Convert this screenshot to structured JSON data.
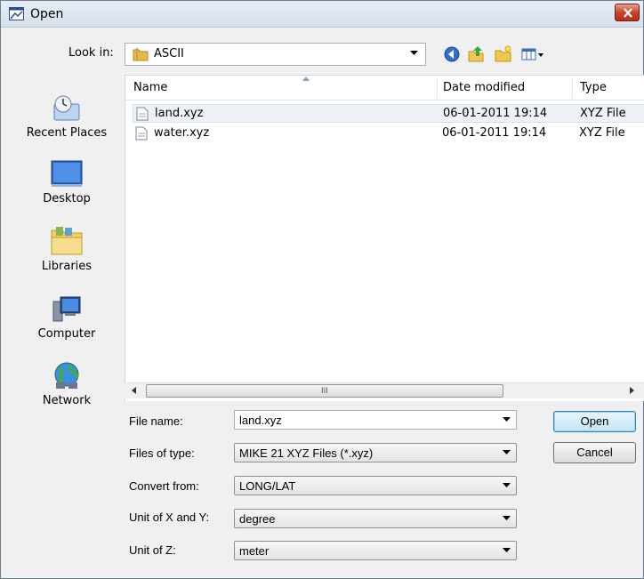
{
  "window": {
    "title": "Open"
  },
  "toolbar": {
    "look_in_label": "Look in:",
    "look_in_value": "ASCII",
    "icons": [
      "back-icon",
      "up-folder-icon",
      "new-folder-icon",
      "view-menu-icon"
    ]
  },
  "places": [
    {
      "label": "Recent Places",
      "icon": "recent-places-icon"
    },
    {
      "label": "Desktop",
      "icon": "desktop-icon"
    },
    {
      "label": "Libraries",
      "icon": "libraries-icon"
    },
    {
      "label": "Computer",
      "icon": "computer-icon"
    },
    {
      "label": "Network",
      "icon": "network-icon"
    }
  ],
  "filelist": {
    "columns": [
      "Name",
      "Date modified",
      "Type"
    ],
    "rows": [
      {
        "name": "land.xyz",
        "date": "06-01-2011 19:14",
        "type": "XYZ File",
        "selected": true
      },
      {
        "name": "water.xyz",
        "date": "06-01-2011 19:14",
        "type": "XYZ File",
        "selected": false
      }
    ],
    "scroll_grip": "III"
  },
  "form": {
    "file_name_label": "File name:",
    "file_name_value": "land.xyz",
    "files_of_type_label": "Files of type:",
    "files_of_type_value": "MIKE 21 XYZ Files (*.xyz)",
    "convert_from_label": "Convert from:",
    "convert_from_value": "LONG/LAT",
    "unit_xy_label": "Unit of X and Y:",
    "unit_xy_value": "degree",
    "unit_z_label": "Unit of Z:",
    "unit_z_value": "meter"
  },
  "buttons": {
    "open": "Open",
    "cancel": "Cancel"
  },
  "colors": {
    "selection": "#eef2f8",
    "close_button": "#c8432a",
    "window_bg": "#f0f0f0"
  }
}
